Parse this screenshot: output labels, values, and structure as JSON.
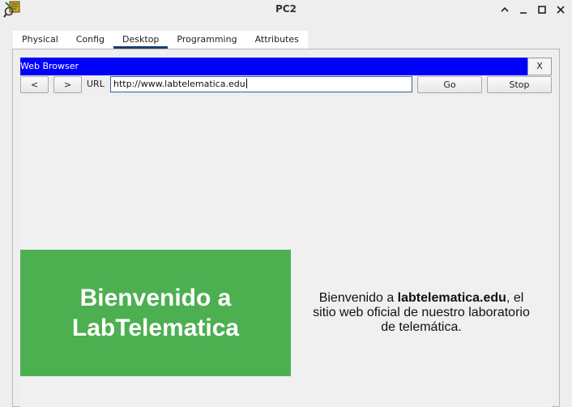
{
  "window": {
    "title": "PC2",
    "controls": [
      "chevron-up-icon",
      "minimize-icon",
      "maximize-icon",
      "close-icon"
    ]
  },
  "tabs": [
    {
      "label": "Physical",
      "active": false
    },
    {
      "label": "Config",
      "active": false
    },
    {
      "label": "Desktop",
      "active": true
    },
    {
      "label": "Programming",
      "active": false
    },
    {
      "label": "Attributes",
      "active": false
    }
  ],
  "browser": {
    "title": "Web Browser",
    "close_label": "X",
    "back_label": "<",
    "forward_label": ">",
    "url_label": "URL",
    "url_value": "http://www.labtelematica.edu",
    "go_label": "Go",
    "stop_label": "Stop",
    "header_color": "#0000ff"
  },
  "page": {
    "hero_line1": "Bienvenido a",
    "hero_line2": "LabTelematica",
    "hero_color": "#4caf50",
    "welcome_prefix": "Bienvenido a ",
    "welcome_site": "labtelematica.edu",
    "welcome_suffix": ", el sitio web oficial de nuestro laboratorio de telemática."
  }
}
